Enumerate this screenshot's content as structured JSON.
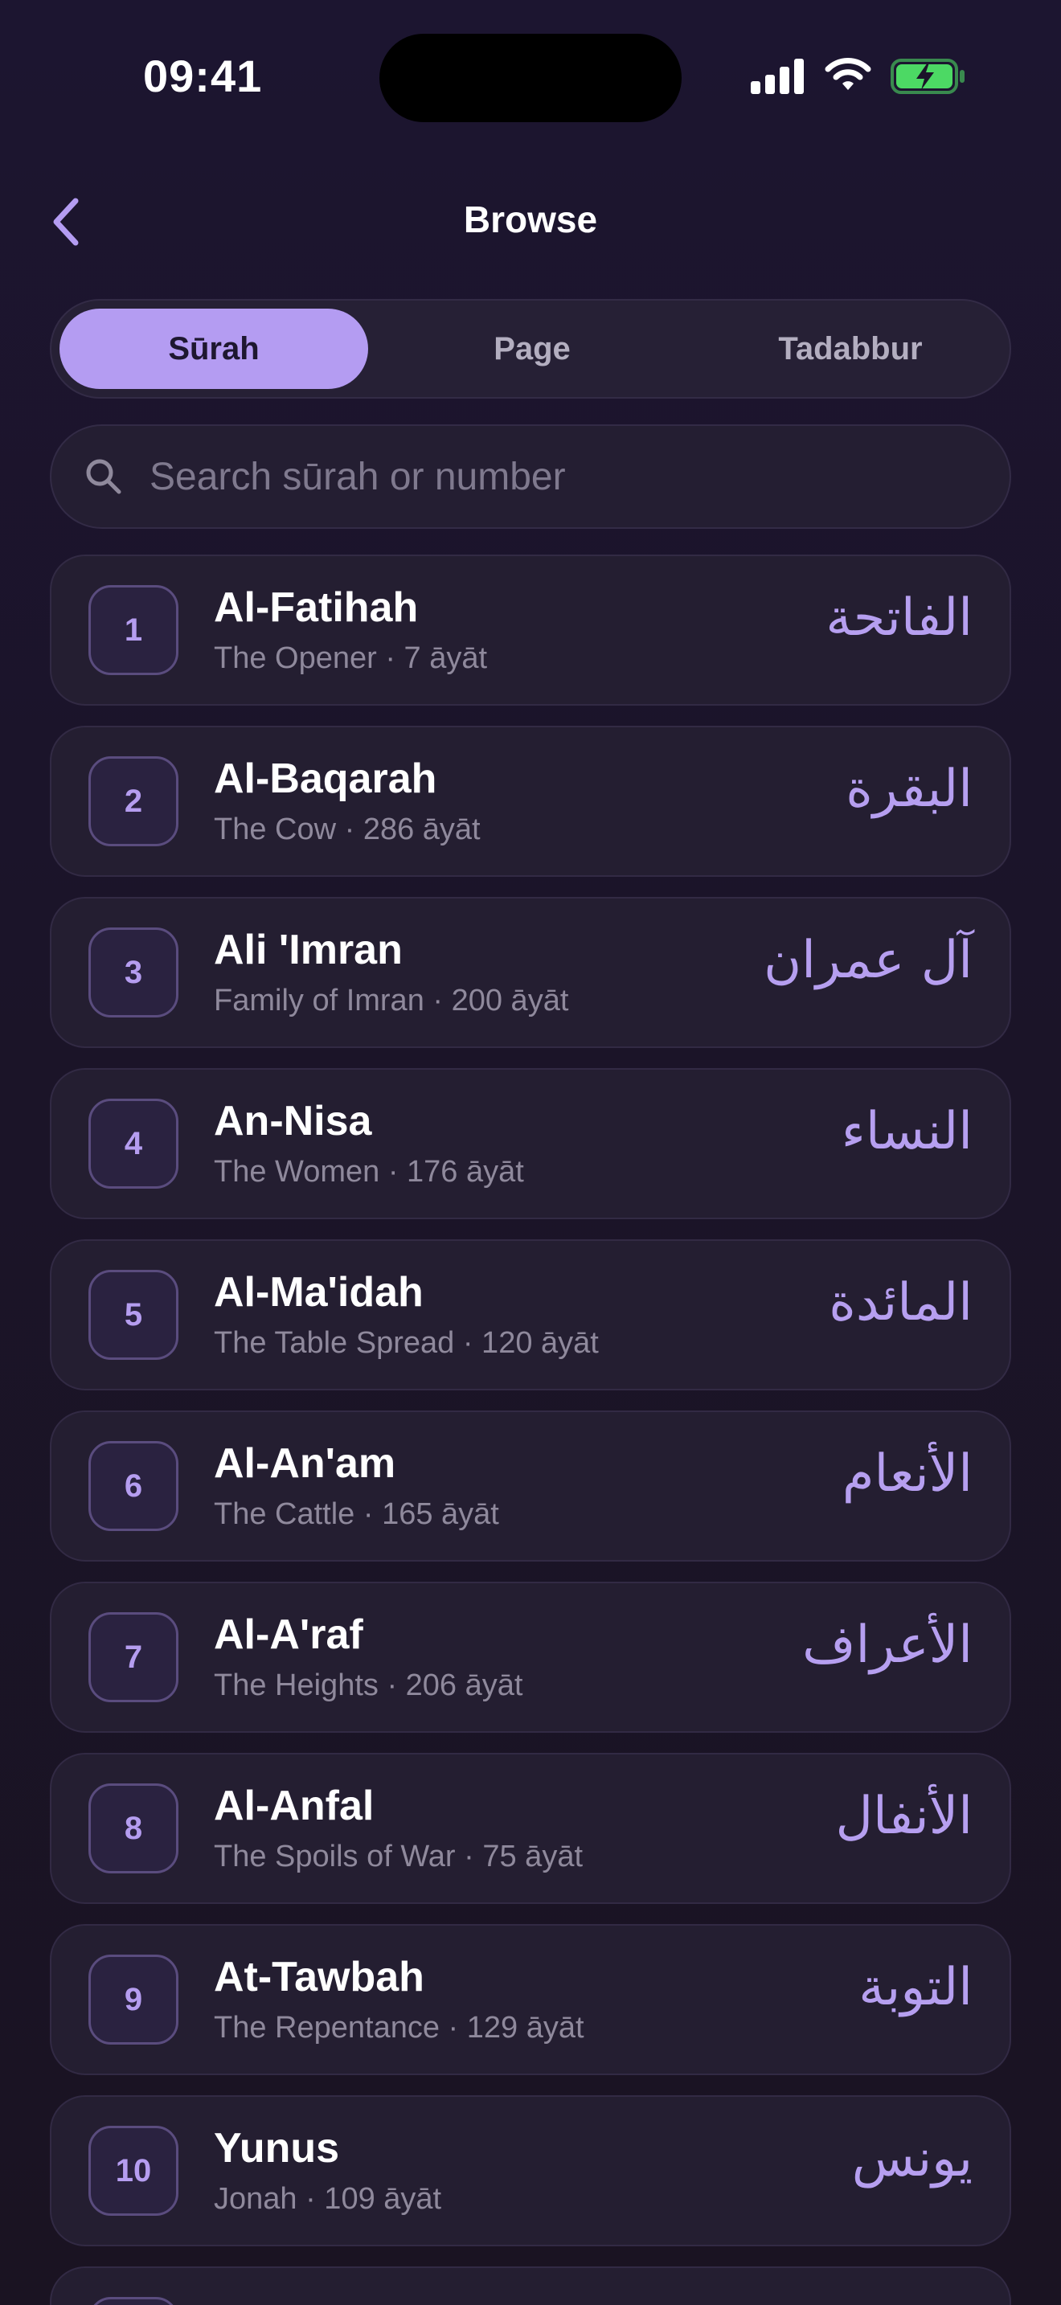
{
  "status_bar": {
    "time": "09:41"
  },
  "header": {
    "title": "Browse"
  },
  "tabs": [
    {
      "label": "Sūrah",
      "active": true
    },
    {
      "label": "Page",
      "active": false
    },
    {
      "label": "Tadabbur",
      "active": false
    }
  ],
  "search": {
    "placeholder": "Search sūrah or number",
    "value": ""
  },
  "surahs": [
    {
      "number": "1",
      "name": "Al-Fatihah",
      "meta": "The Opener · 7 āyāt",
      "arabic": "الفاتحة"
    },
    {
      "number": "2",
      "name": "Al-Baqarah",
      "meta": "The Cow · 286 āyāt",
      "arabic": "البقرة"
    },
    {
      "number": "3",
      "name": "Ali 'Imran",
      "meta": "Family of Imran · 200 āyāt",
      "arabic": "آل عمران"
    },
    {
      "number": "4",
      "name": "An-Nisa",
      "meta": "The Women · 176 āyāt",
      "arabic": "النساء"
    },
    {
      "number": "5",
      "name": "Al-Ma'idah",
      "meta": "The Table Spread · 120 āyāt",
      "arabic": "المائدة"
    },
    {
      "number": "6",
      "name": "Al-An'am",
      "meta": "The Cattle · 165 āyāt",
      "arabic": "الأنعام"
    },
    {
      "number": "7",
      "name": "Al-A'raf",
      "meta": "The Heights · 206 āyāt",
      "arabic": "الأعراف"
    },
    {
      "number": "8",
      "name": "Al-Anfal",
      "meta": "The Spoils of War · 75 āyāt",
      "arabic": "الأنفال"
    },
    {
      "number": "9",
      "name": "At-Tawbah",
      "meta": "The Repentance · 129 āyāt",
      "arabic": "التوبة"
    },
    {
      "number": "10",
      "name": "Yunus",
      "meta": "Jonah · 109 āyāt",
      "arabic": "يونس"
    },
    {
      "number": "",
      "name": "",
      "meta": "",
      "arabic": ""
    }
  ],
  "colors": {
    "accent": "#b49cf2",
    "background": "#1b1429",
    "card": "#241e31",
    "battery": "#4cd964"
  }
}
